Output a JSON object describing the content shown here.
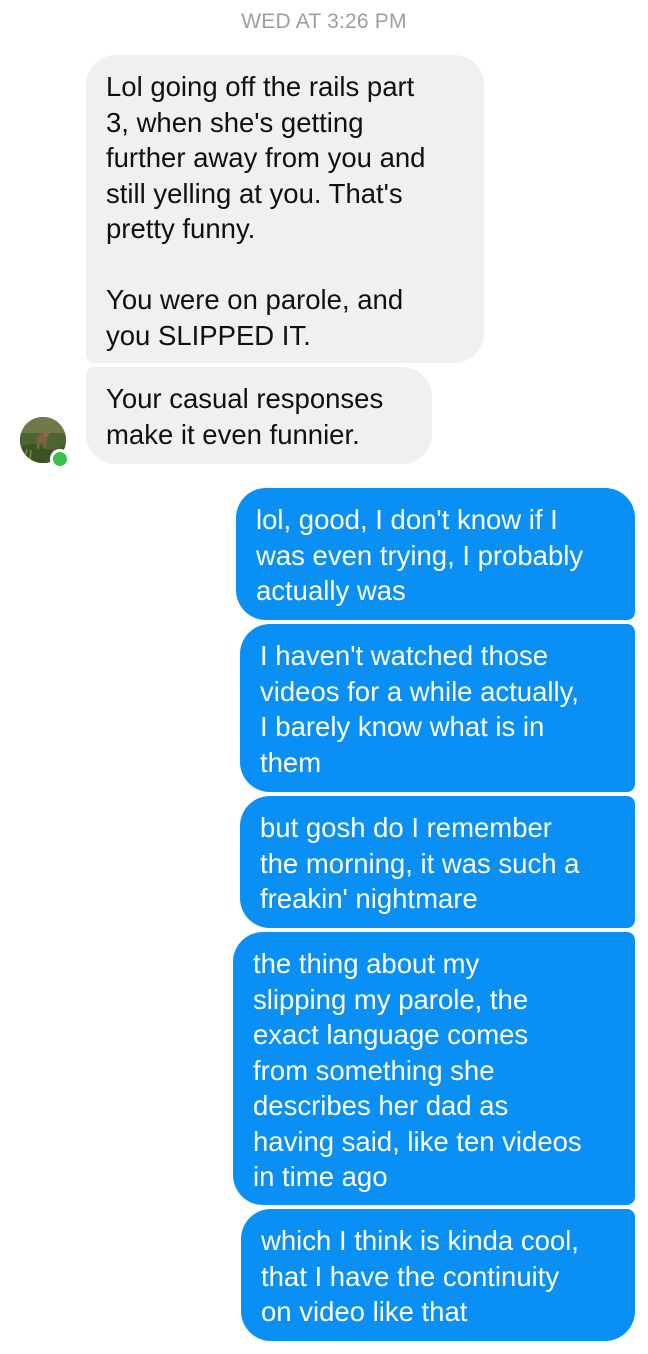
{
  "thread": {
    "timestamp": "WED AT 3:26 PM"
  },
  "contact": {
    "avatar_icon": "profile-photo-deer-in-grass",
    "online_status_color": "#3ac24a"
  },
  "colors": {
    "incoming_bubble": "#f0f0f0",
    "outgoing_bubble": "#0a8ff5"
  },
  "messages": [
    {
      "direction": "incoming",
      "text": "Lol going off the rails part\n3, when she's getting\nfurther away from you and\nstill yelling at you. That's\npretty funny.\n\nYou were on parole, and\nyou SLIPPED IT."
    },
    {
      "direction": "incoming",
      "text": "Your casual responses\nmake it even funnier."
    },
    {
      "direction": "outgoing",
      "text": "lol, good, I don't know if I\nwas even trying, I probably\nactually was"
    },
    {
      "direction": "outgoing",
      "text": "I haven't watched those\nvideos for a while actually,\nI barely know what is in\nthem"
    },
    {
      "direction": "outgoing",
      "text": "but gosh do I remember\nthe morning, it was such a\nfreakin' nightmare"
    },
    {
      "direction": "outgoing",
      "text": "the thing about my\nslipping my parole, the\nexact language comes\nfrom something she\ndescribes her dad as\nhaving said, like ten videos\nin time ago"
    },
    {
      "direction": "outgoing",
      "text": "which I think is kinda cool,\nthat I have the continuity\non video like that"
    }
  ]
}
